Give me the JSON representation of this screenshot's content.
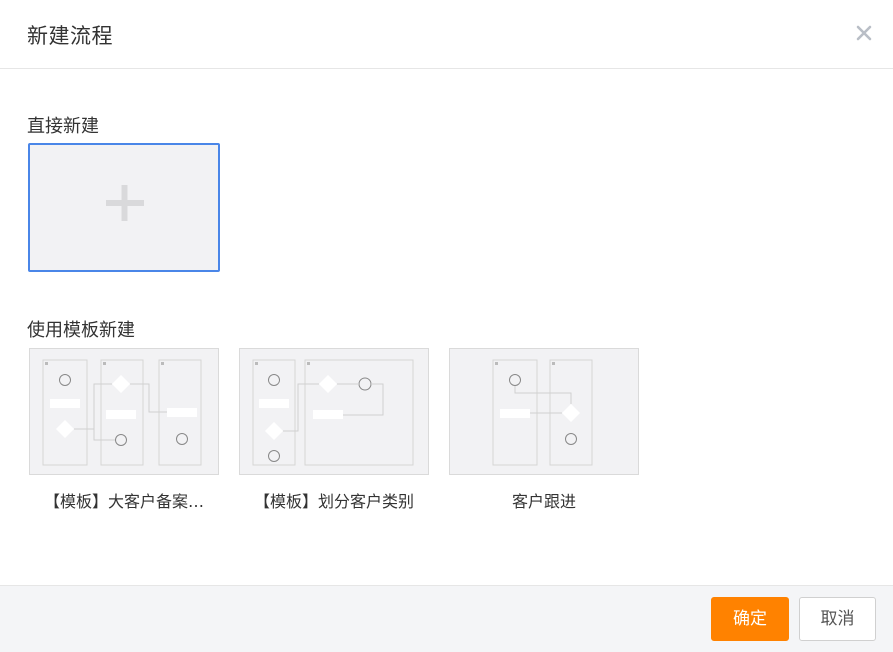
{
  "dialog": {
    "title": "新建流程"
  },
  "direct": {
    "label": "直接新建"
  },
  "templates": {
    "label": "使用模板新建",
    "items": [
      {
        "name": "【模板】大客户备案…"
      },
      {
        "name": "【模板】划分客户类别"
      },
      {
        "name": "客户跟进"
      }
    ]
  },
  "footer": {
    "ok_label": "确定",
    "cancel_label": "取消"
  },
  "colors": {
    "accent": "#ff8200",
    "selected_border": "#4a86e8"
  },
  "icons": {
    "close": "close-icon",
    "add": "plus-icon"
  }
}
